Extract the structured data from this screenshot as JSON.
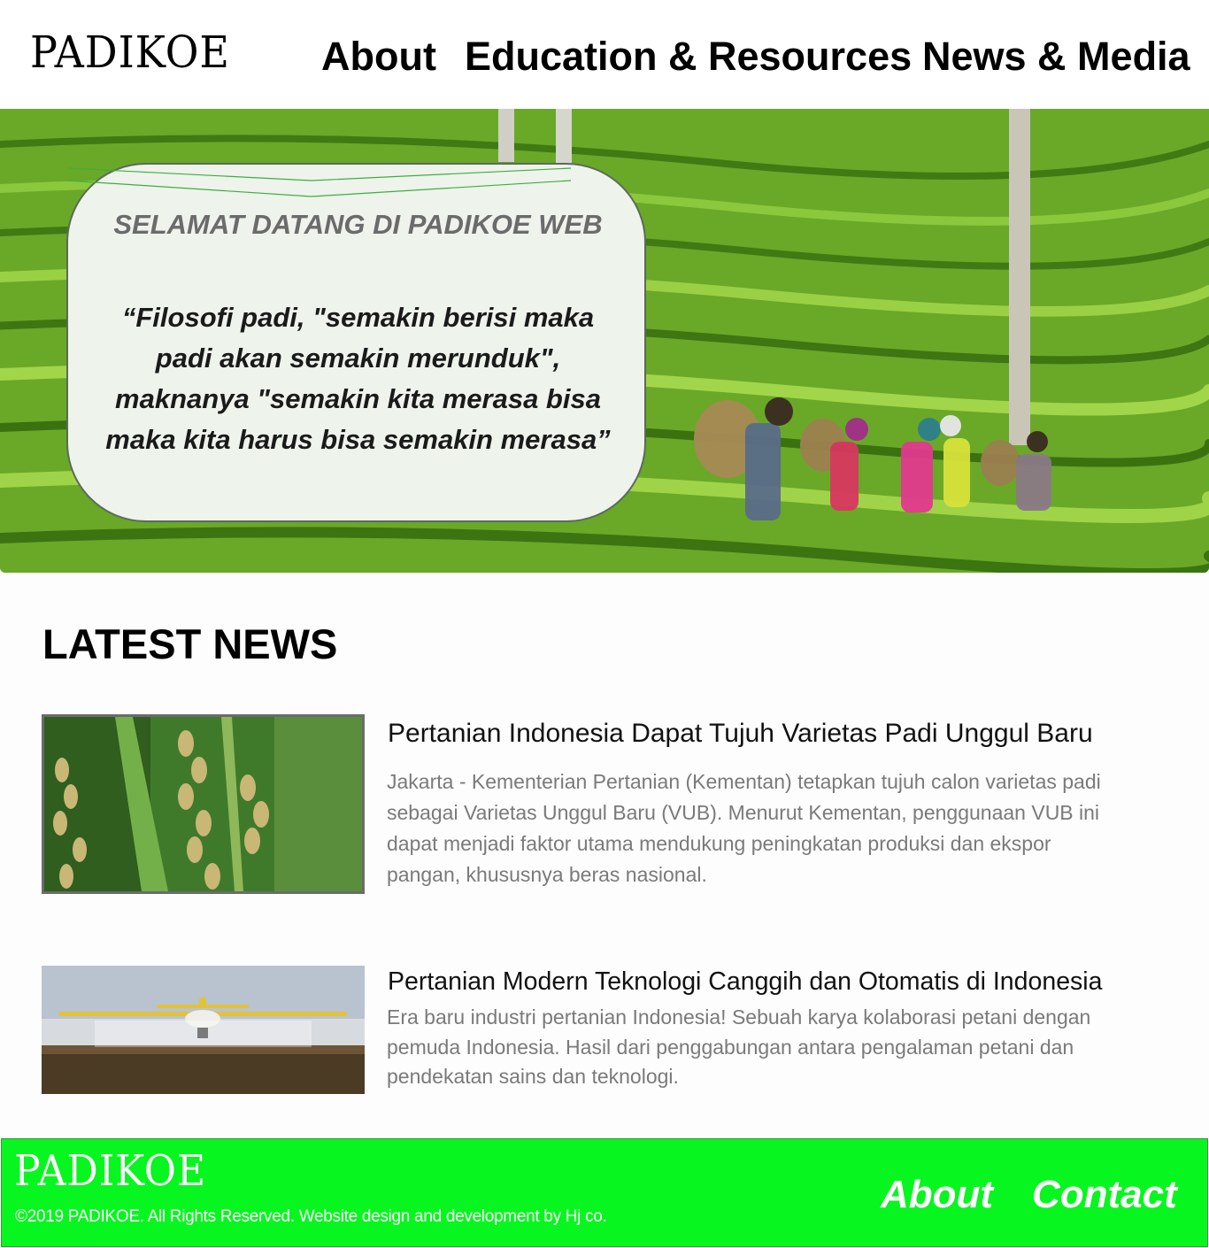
{
  "header": {
    "logo": "PADIKOE",
    "nav": [
      {
        "label": "About"
      },
      {
        "label": "Education & Resources"
      },
      {
        "label": "News & Media"
      }
    ]
  },
  "hero": {
    "welcome_title": "SELAMAT DATANG DI PADIKOE WEB",
    "quote": "“Filosofi padi, \"semakin berisi maka padi akan semakin merunduk\", maknanya \"semakin kita merasa bisa maka kita harus bisa semakin merasa”"
  },
  "latest_news": {
    "title": "LATEST NEWS",
    "items": [
      {
        "title": "Pertanian Indonesia Dapat Tujuh Varietas Padi Unggul Baru",
        "summary": "Jakarta - Kementerian Pertanian (Kementan) tetapkan tujuh calon varietas padi sebagai Varietas Unggul Baru (VUB). Menurut Kementan, penggunaan VUB ini dapat menjadi faktor utama mendukung peningkatan produksi dan ekspor pangan, khususnya beras nasional."
      },
      {
        "title": "Pertanian Modern Teknologi Canggih dan Otomatis di Indonesia",
        "summary": "Era baru industri pertanian Indonesia! Sebuah karya kolaborasi petani dengan pemuda Indonesia. Hasil dari penggabungan antara pengalaman petani dan pendekatan sains dan teknologi."
      }
    ]
  },
  "footer": {
    "logo": "PADIKOE",
    "copyright": "©2019 PADIKOE. All Rights Reserved. Website design and development by Hj co.",
    "links": [
      {
        "label": "About"
      },
      {
        "label": "Contact"
      }
    ]
  },
  "colors": {
    "footer_bg": "#07f61f",
    "welcome_box_bg": "#eef3ec",
    "summary_text": "#7a7a7a"
  }
}
